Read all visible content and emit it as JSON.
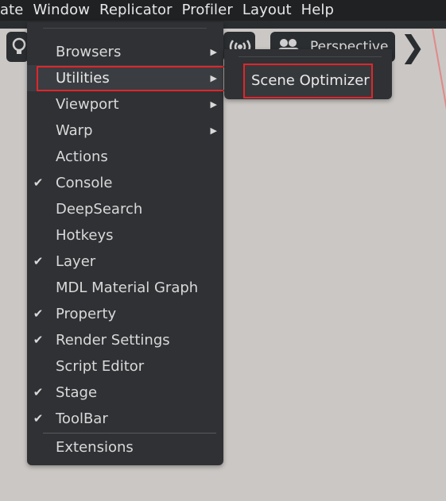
{
  "menubar": {
    "items": [
      "ate",
      "Window",
      "Replicator",
      "Profiler",
      "Layout",
      "Help"
    ]
  },
  "viewport": {
    "camera_label": "Perspective"
  },
  "window_menu": {
    "items": [
      {
        "label": "Browsers",
        "submenu": true,
        "checked": false
      },
      {
        "label": "Utilities",
        "submenu": true,
        "checked": false,
        "highlighted": true
      },
      {
        "label": "Viewport",
        "submenu": true,
        "checked": false
      },
      {
        "label": "Warp",
        "submenu": true,
        "checked": false
      },
      {
        "label": "Actions",
        "submenu": false,
        "checked": false
      },
      {
        "label": "Console",
        "submenu": false,
        "checked": true
      },
      {
        "label": "DeepSearch",
        "submenu": false,
        "checked": false
      },
      {
        "label": "Hotkeys",
        "submenu": false,
        "checked": false
      },
      {
        "label": "Layer",
        "submenu": false,
        "checked": true
      },
      {
        "label": "MDL Material Graph",
        "submenu": false,
        "checked": false
      },
      {
        "label": "Property",
        "submenu": false,
        "checked": true
      },
      {
        "label": "Render Settings",
        "submenu": false,
        "checked": true
      },
      {
        "label": "Script Editor",
        "submenu": false,
        "checked": false
      },
      {
        "label": "Stage",
        "submenu": false,
        "checked": true
      },
      {
        "label": "ToolBar",
        "submenu": false,
        "checked": true
      }
    ],
    "extensions_label": "Extensions"
  },
  "utilities_submenu": {
    "items": [
      {
        "label": "Scene Optimizer"
      }
    ]
  },
  "icons": {
    "check": "check-icon",
    "arrow": "chevron-right-icon"
  },
  "colors": {
    "highlight_border": "#e0262b",
    "menu_bg": "#2f3134",
    "menubar_bg": "#1f2123"
  }
}
